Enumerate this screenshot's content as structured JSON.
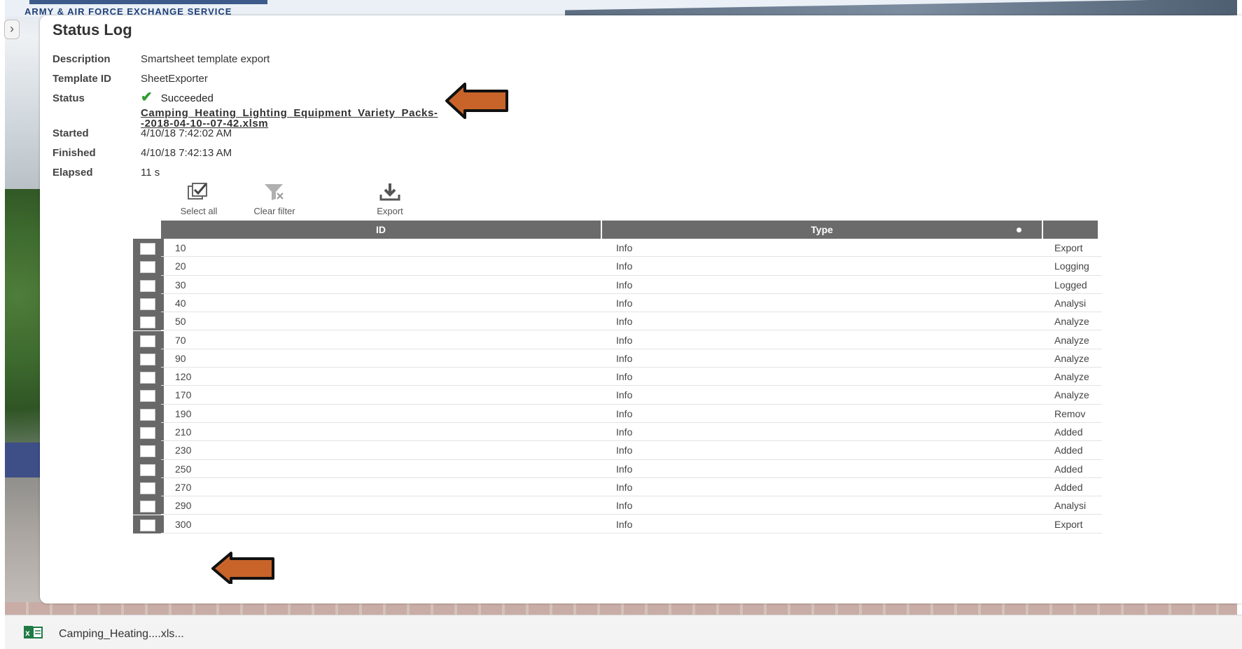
{
  "brand": "ARMY & AIR FORCE EXCHANGE SERVICE",
  "panel": {
    "title": "Status Log",
    "fields": {
      "description_label": "Description",
      "description_value": "Smartsheet template export",
      "template_label": "Template ID",
      "template_value": "SheetExporter",
      "status_label": "Status",
      "status_value": "Succeeded",
      "file_link_line1": "Camping_Heating_Lighting_Equipment_Variety_Packs-",
      "file_link_line2": "-2018-04-10--07-42.xlsm",
      "started_label": "Started",
      "started_value": "4/10/18 7:42:02 AM",
      "finished_label": "Finished",
      "finished_value": "4/10/18 7:42:13 AM",
      "elapsed_label": "Elapsed",
      "elapsed_value": "11 s"
    },
    "toolbar": {
      "select_all": "Select all",
      "clear_filter": "Clear filter",
      "export": "Export"
    },
    "table": {
      "columns": [
        "ID",
        "Type",
        ""
      ],
      "rows": [
        {
          "id": "10",
          "type": "Info",
          "message": "Export"
        },
        {
          "id": "20",
          "type": "Info",
          "message": "Logging"
        },
        {
          "id": "30",
          "type": "Info",
          "message": "Logged"
        },
        {
          "id": "40",
          "type": "Info",
          "message": "Analysi"
        },
        {
          "id": "50",
          "type": "Info",
          "message": "Analyze"
        },
        {
          "id": "70",
          "type": "Info",
          "message": "Analyze"
        },
        {
          "id": "90",
          "type": "Info",
          "message": "Analyze"
        },
        {
          "id": "120",
          "type": "Info",
          "message": "Analyze"
        },
        {
          "id": "170",
          "type": "Info",
          "message": "Analyze"
        },
        {
          "id": "190",
          "type": "Info",
          "message": "Remov"
        },
        {
          "id": "210",
          "type": "Info",
          "message": "Added"
        },
        {
          "id": "230",
          "type": "Info",
          "message": "Added"
        },
        {
          "id": "250",
          "type": "Info",
          "message": "Added"
        },
        {
          "id": "270",
          "type": "Info",
          "message": "Added"
        },
        {
          "id": "290",
          "type": "Info",
          "message": "Analysi"
        },
        {
          "id": "300",
          "type": "Info",
          "message": "Export"
        }
      ]
    }
  },
  "download": {
    "filename": "Camping_Heating....xls..."
  },
  "colors": {
    "arrow_fill": "#c8642a",
    "header_bg": "#6b6b6b",
    "check": "#2e9c2e"
  },
  "icons": [
    "expand-chevron-icon",
    "checkmark-icon",
    "select-all-icon",
    "clear-filter-icon",
    "export-download-icon",
    "excel-file-icon",
    "orange-arrow-icon"
  ]
}
